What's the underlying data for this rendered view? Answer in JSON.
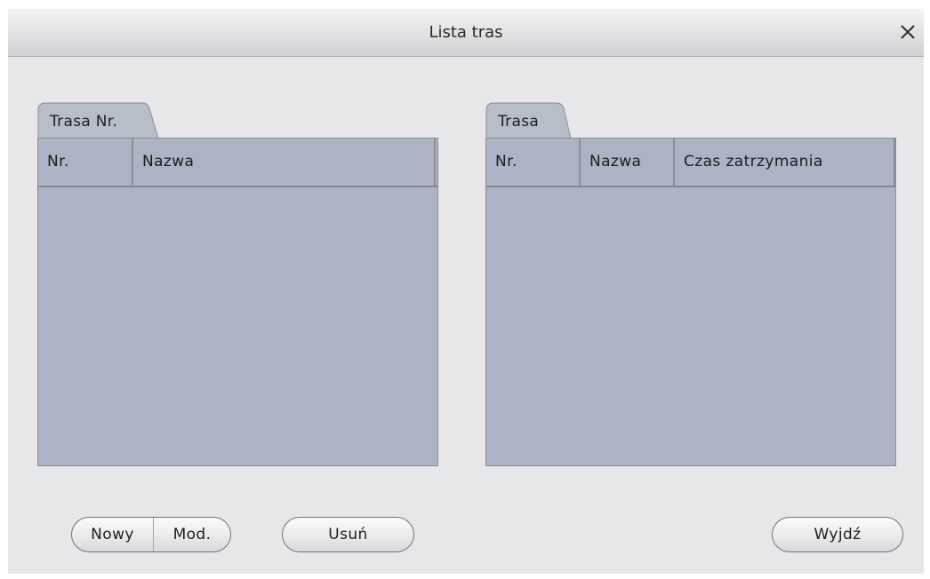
{
  "window": {
    "title": "Lista tras",
    "close_icon": "close-icon"
  },
  "left_panel": {
    "tab_label": "Trasa Nr.",
    "columns": [
      "Nr.",
      "Nazwa"
    ],
    "rows": []
  },
  "right_panel": {
    "tab_label": "Trasa",
    "columns": [
      "Nr.",
      "Nazwa",
      "Czas zatrzymania"
    ],
    "rows": []
  },
  "buttons": {
    "new_label": "Nowy",
    "modify_label": "Mod.",
    "delete_label": "Usuń",
    "exit_label": "Wyjdź"
  },
  "colors": {
    "dialog_bg": "#e6e7e9",
    "panel_bg": "#adb3c3",
    "header_border": "#82868f"
  }
}
